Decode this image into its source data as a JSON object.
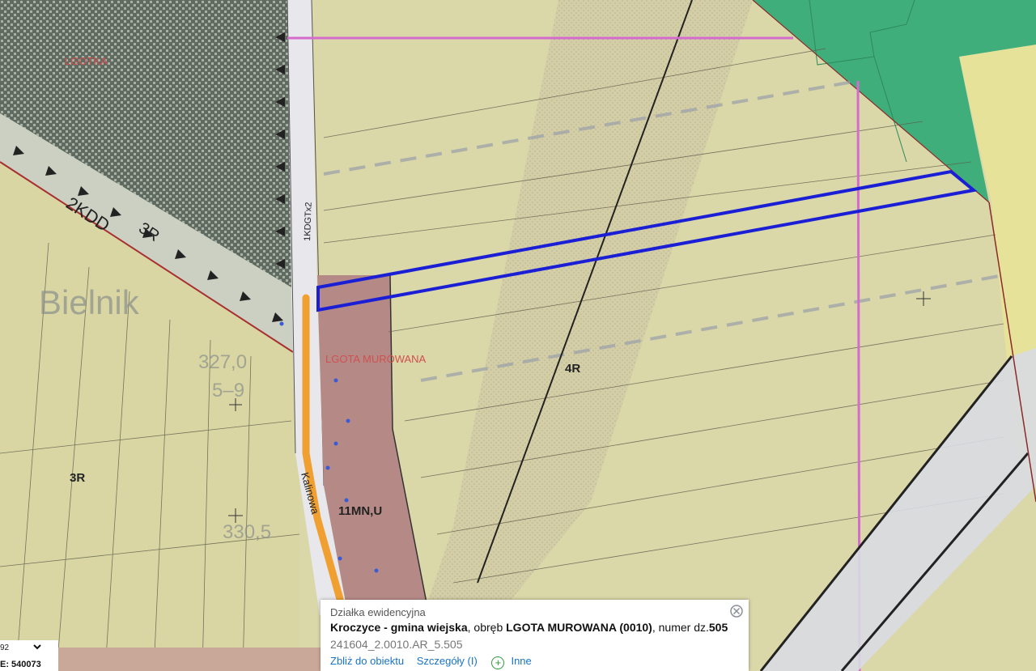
{
  "map": {
    "labels": {
      "lgotka": "LGOTKA",
      "road_2kdd": "2KDD",
      "zone_3r_top": "3R",
      "bielnik": "Bielnik",
      "elev_327": "327,0",
      "sheet_5_9": "5–9",
      "lgota_murowana": "LGOTA MUROWANA",
      "road_1kdgtx2": "1KDGTx2",
      "zone_4r": "4R",
      "zone_3r_left": "3R",
      "kalinowa": "Kalinowa",
      "zone_11mnu": "11MN,U",
      "elev_330": "330,5"
    },
    "colors": {
      "parcel_outline": "#1a1fd6",
      "road_highlight": "#f0a030",
      "boundary_pink": "#d46ccc",
      "residential_zone": "#b58a86",
      "forest_green": "#3fae7a",
      "hatched_zone": "#3d4a44",
      "road_white": "#e8e8ec"
    }
  },
  "popup": {
    "title": "Działka ewidencyjna",
    "municipality": "Kroczyce - gmina wiejska",
    "precinct_prefix": ", obręb ",
    "precinct": "LGOTA MUROWANA (0010)",
    "number_prefix": ", numer dz.",
    "number": "505",
    "parcel_code": "241604_2.0010.AR_5.505",
    "actions": {
      "zoom": "Zbliż do obiektu",
      "details": "Szczegóły (I)",
      "other": "Inne"
    }
  },
  "coord_panel": {
    "crs_partial": "92",
    "coordinate": "E: 540073"
  }
}
